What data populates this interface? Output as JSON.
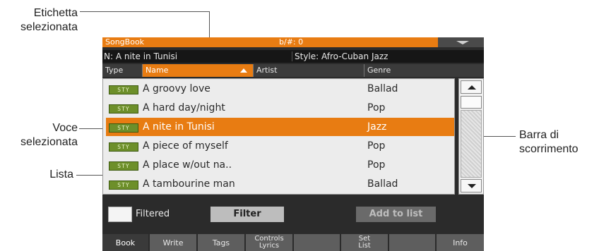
{
  "annotations": {
    "selected_label": [
      "Etichetta",
      "selezionata"
    ],
    "selected_item": [
      "Voce",
      "selezionata"
    ],
    "list": "Lista",
    "scrollbar": [
      "Barra di",
      "scorrimento"
    ]
  },
  "topbar": {
    "title": "SongBook",
    "key_info": "b/#: 0"
  },
  "info": {
    "name": "N: A nite in Tunisi",
    "style": "Style: Afro-Cuban Jazz"
  },
  "columns": [
    "Type",
    "Name",
    "Artist",
    "Genre"
  ],
  "rows": [
    {
      "type": "STY",
      "name": "A groovy love",
      "genre": "Ballad",
      "selected": false
    },
    {
      "type": "STY",
      "name": "A hard day/night",
      "genre": "Pop",
      "selected": false
    },
    {
      "type": "STY",
      "name": "A nite in Tunisi",
      "genre": "Jazz",
      "selected": true
    },
    {
      "type": "STY",
      "name": "A piece of myself",
      "genre": "Pop",
      "selected": false
    },
    {
      "type": "STY",
      "name": "A place w/out na..",
      "genre": "Pop",
      "selected": false
    },
    {
      "type": "STY",
      "name": "A tambourine man",
      "genre": "Ballad",
      "selected": false
    }
  ],
  "filter": {
    "label": "Filtered",
    "button": "Filter",
    "add_button": "Add to list"
  },
  "tabs": [
    {
      "label": "Book",
      "active": true
    },
    {
      "label": "Write",
      "active": false
    },
    {
      "label": "Tags",
      "active": false
    },
    {
      "label": "Controls\nLyrics",
      "active": false
    },
    {
      "label": "",
      "active": false
    },
    {
      "label": "Set\nList",
      "active": false
    },
    {
      "label": "",
      "active": false
    },
    {
      "label": "Info",
      "active": false
    }
  ],
  "colors": {
    "accent": "#e87c12",
    "background": "#2b2b2b",
    "list_bg": "#ececec",
    "badge": "#6d8f2a"
  }
}
